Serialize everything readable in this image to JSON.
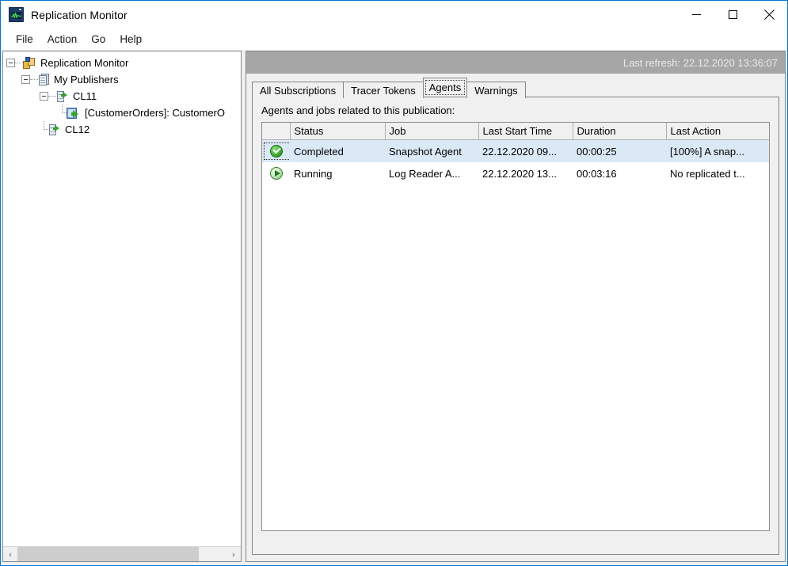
{
  "window": {
    "title": "Replication Monitor",
    "icon": "replication-monitor-icon",
    "minimize_label": "—",
    "maximize_label": "□",
    "close_label": "✕"
  },
  "menubar": {
    "items": [
      {
        "label": "File"
      },
      {
        "label": "Action"
      },
      {
        "label": "Go"
      },
      {
        "label": "Help"
      }
    ]
  },
  "tree": {
    "nodes": [
      {
        "label": "Replication Monitor",
        "icon": "replication-monitor-node-icon",
        "level": 0,
        "expanded": true
      },
      {
        "label": "My Publishers",
        "icon": "publishers-folder-icon",
        "level": 1,
        "expanded": true
      },
      {
        "label": "CL11",
        "icon": "publisher-server-icon",
        "level": 2,
        "expanded": true
      },
      {
        "label": "[CustomerOrders]: CustomerO",
        "icon": "publication-icon",
        "level": 3,
        "expanded": false
      },
      {
        "label": "CL12",
        "icon": "publisher-server-icon",
        "level": 2,
        "expanded": false
      }
    ],
    "scrollbar": {
      "left_arrow": "‹",
      "right_arrow": "›"
    }
  },
  "content": {
    "last_refresh": "Last refresh: 22.12.2020 13:36:07",
    "tabs": [
      {
        "label": "All Subscriptions",
        "active": false
      },
      {
        "label": "Tracer Tokens",
        "active": false
      },
      {
        "label": "Agents",
        "active": true
      },
      {
        "label": "Warnings",
        "active": false
      }
    ],
    "panel_caption": "Agents and jobs related to this publication:",
    "table": {
      "columns": [
        "",
        "Status",
        "Job",
        "Last Start Time",
        "Duration",
        "Last Action"
      ],
      "rows": [
        {
          "status_icon": "status-completed-icon",
          "status": "Completed",
          "job": "Snapshot Agent",
          "last_start_time": "22.12.2020 09...",
          "duration": "00:00:25",
          "last_action": "[100%] A snap...",
          "selected": true,
          "focused": true
        },
        {
          "status_icon": "status-running-icon",
          "status": "Running",
          "job": "Log Reader A...",
          "last_start_time": "22.12.2020 13...",
          "duration": "00:03:16",
          "last_action": "No replicated t...",
          "selected": false,
          "focused": false
        }
      ]
    }
  },
  "colors": {
    "accent": "#0078d7",
    "refresh_bar_bg": "#a6a6a6",
    "selected_row": "#dbe9f7",
    "status_green": "#34a033",
    "chrome": "#f0f0f0"
  }
}
